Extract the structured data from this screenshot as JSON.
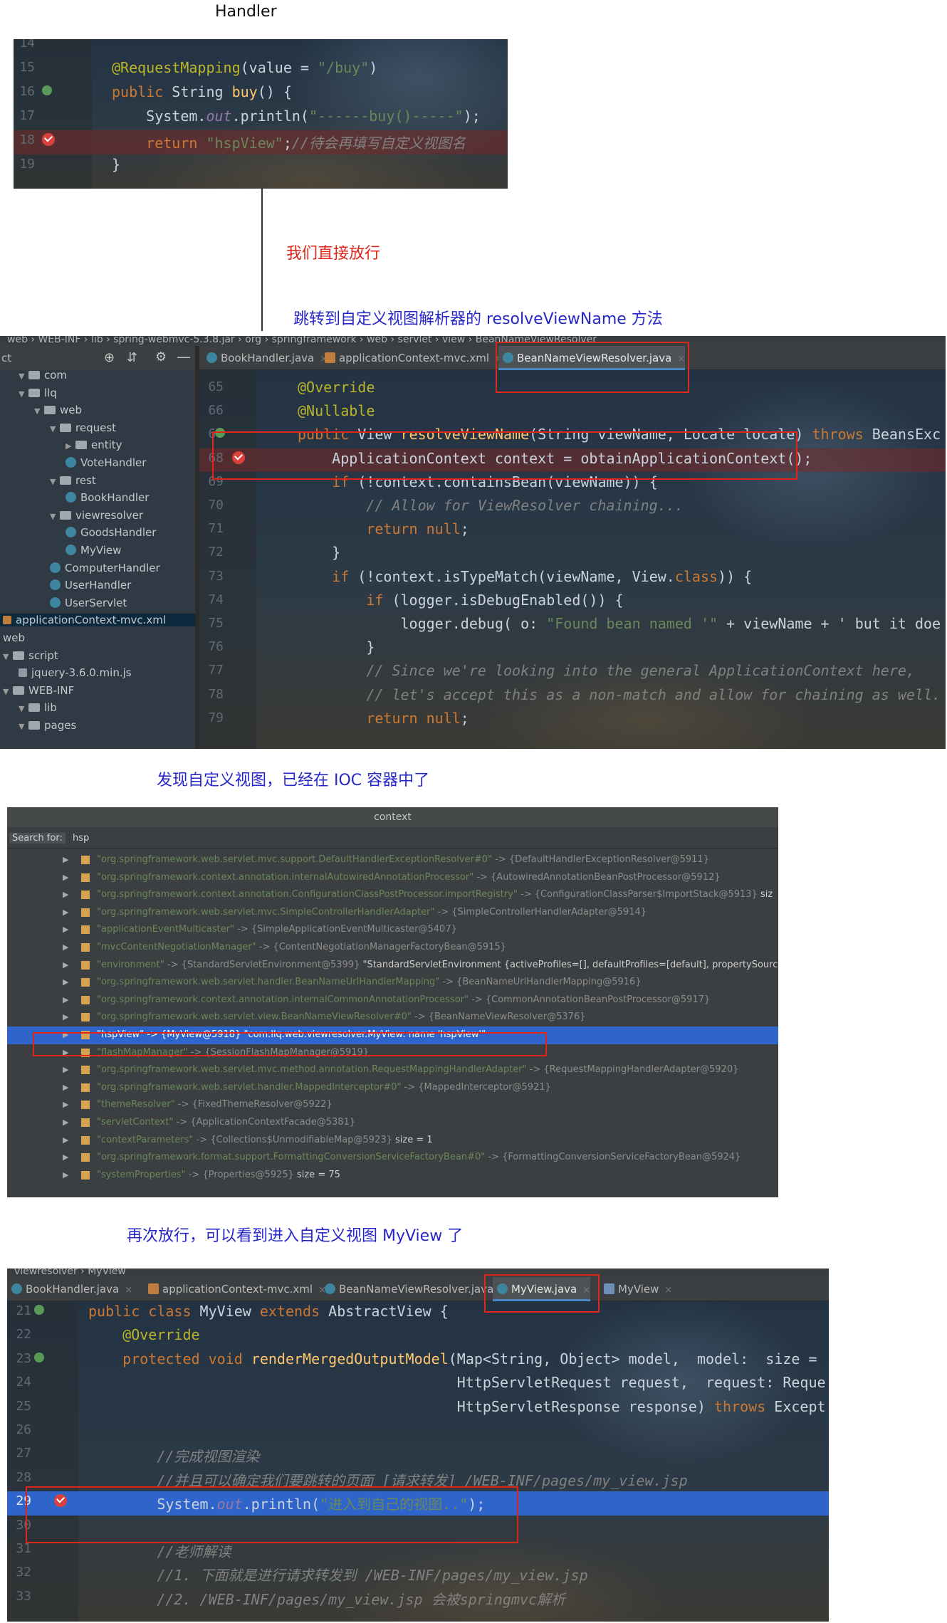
{
  "annotations": {
    "handler_label": "Handler",
    "step1": "我们直接放行",
    "step2": "跳转到自定义视图解析器的 resolveViewName 方法",
    "step3": "发现自定义视图，已经在 IOC 容器中了",
    "step4": "再次放行，可以看到进入自定义视图 MyView 了"
  },
  "colors": {
    "annotation_red": "#e0261b",
    "annotation_blue": "#2727c9",
    "editor_bg": "#27313c",
    "selection_blue": "#2f65ca"
  },
  "panel1": {
    "lines": [
      {
        "num": "14",
        "code": ""
      },
      {
        "num": "15",
        "code": "@RequestMapping(value = \"/buy\")"
      },
      {
        "num": "16",
        "code": "public String buy() {"
      },
      {
        "num": "17",
        "code": "    System.out.println(\"------buy()-----\");"
      },
      {
        "num": "18",
        "code": "    return \"hspView\";//待会再填写自定义视图名"
      },
      {
        "num": "19",
        "code": "}"
      }
    ]
  },
  "panel2": {
    "breadcrumb": [
      "web",
      "WEB-INF",
      "lib",
      "spring-webmvc-5.3.8.jar",
      "org",
      "springframework",
      "web",
      "servlet",
      "view",
      "BeanNameViewResolver"
    ],
    "tabs": [
      {
        "label": "BookHandler.java",
        "icon": "class-icon"
      },
      {
        "label": "applicationContext-mvc.xml",
        "icon": "xml-icon"
      },
      {
        "label": "BeanNameViewResolver.java",
        "icon": "class-icon",
        "active": true
      }
    ],
    "tree": [
      {
        "label": "ct",
        "kind": "text"
      },
      {
        "label": "com",
        "kind": "folder"
      },
      {
        "label": "llq",
        "kind": "folder"
      },
      {
        "label": "web",
        "kind": "folder"
      },
      {
        "label": "request",
        "kind": "folder"
      },
      {
        "label": "entity",
        "kind": "folder"
      },
      {
        "label": "VoteHandler",
        "kind": "class"
      },
      {
        "label": "rest",
        "kind": "folder"
      },
      {
        "label": "BookHandler",
        "kind": "class"
      },
      {
        "label": "viewresolver",
        "kind": "folder"
      },
      {
        "label": "GoodsHandler",
        "kind": "class"
      },
      {
        "label": "MyView",
        "kind": "class"
      },
      {
        "label": "ComputerHandler",
        "kind": "class"
      },
      {
        "label": "UserHandler",
        "kind": "class"
      },
      {
        "label": "UserServlet",
        "kind": "class"
      },
      {
        "label": "applicationContext-mvc.xml",
        "kind": "xml"
      },
      {
        "label": "web",
        "kind": "text"
      },
      {
        "label": "script",
        "kind": "folder"
      },
      {
        "label": "jquery-3.6.0.min.js",
        "kind": "file"
      },
      {
        "label": "WEB-INF",
        "kind": "folder"
      },
      {
        "label": "lib",
        "kind": "folder"
      },
      {
        "label": "pages",
        "kind": "folder"
      }
    ],
    "lines": [
      {
        "num": "65",
        "code": "@Override"
      },
      {
        "num": "66",
        "code": "@Nullable"
      },
      {
        "num": "67",
        "code": "public View resolveViewName(String viewName, Locale locale) throws BeansExc"
      },
      {
        "num": "68",
        "code": "    ApplicationContext context = obtainApplicationContext();"
      },
      {
        "num": "69",
        "code": "    if (!context.containsBean(viewName)) {"
      },
      {
        "num": "70",
        "code": "        // Allow for ViewResolver chaining..."
      },
      {
        "num": "71",
        "code": "        return null;"
      },
      {
        "num": "72",
        "code": "    }"
      },
      {
        "num": "73",
        "code": "    if (!context.isTypeMatch(viewName, View.class)) {"
      },
      {
        "num": "74",
        "code": "        if (logger.isDebugEnabled()) {"
      },
      {
        "num": "75",
        "code": "            logger.debug( o: \"Found bean named '\" + viewName + \"' but it doe"
      },
      {
        "num": "76",
        "code": "        }"
      },
      {
        "num": "77",
        "code": "        // Since we're looking into the general ApplicationContext here,"
      },
      {
        "num": "78",
        "code": "        // let's accept this as a non-match and allow for chaining as well."
      },
      {
        "num": "79",
        "code": "        return null;"
      }
    ]
  },
  "panel3": {
    "title": "context",
    "search_label": "Search for:",
    "search_value": "hsp",
    "rows": [
      {
        "key": "\"org.springframework.web.servlet.mvc.support.DefaultHandlerExceptionResolver#0\"",
        "val": " -> {DefaultHandlerExceptionResolver@5911}",
        "extra": ""
      },
      {
        "key": "\"org.springframework.context.annotation.internalAutowiredAnnotationProcessor\"",
        "val": " -> {AutowiredAnnotationBeanPostProcessor@5912}",
        "extra": ""
      },
      {
        "key": "\"org.springframework.context.annotation.ConfigurationClassPostProcessor.importRegistry\"",
        "val": " -> {ConfigurationClassParser$ImportStack@5913}",
        "extra": "  siz"
      },
      {
        "key": "\"org.springframework.web.servlet.mvc.SimpleControllerHandlerAdapter\"",
        "val": " -> {SimpleControllerHandlerAdapter@5914}",
        "extra": ""
      },
      {
        "key": "\"applicationEventMulticaster\"",
        "val": " -> {SimpleApplicationEventMulticaster@5407}",
        "extra": ""
      },
      {
        "key": "\"mvcContentNegotiationManager\"",
        "val": " -> {ContentNegotiationManagerFactoryBean@5915}",
        "extra": ""
      },
      {
        "key": "\"environment\"",
        "val": " -> {StandardServletEnvironment@5399}",
        "extra": " \"StandardServletEnvironment {activeProfiles=[], defaultProfiles=[default], propertySource"
      },
      {
        "key": "\"org.springframework.web.servlet.handler.BeanNameUrlHandlerMapping\"",
        "val": " -> {BeanNameUrlHandlerMapping@5916}",
        "extra": ""
      },
      {
        "key": "\"org.springframework.context.annotation.internalCommonAnnotationProcessor\"",
        "val": " -> {CommonAnnotationBeanPostProcessor@5917}",
        "extra": ""
      },
      {
        "key": "\"org.springframework.web.servlet.view.BeanNameViewResolver#0\"",
        "val": " -> {BeanNameViewResolver@5376}",
        "extra": ""
      },
      {
        "key": "\"hspView\"",
        "val": " -> {MyView@5918}",
        "extra": " \"com.llq.web.viewresolver.MyView: name 'hspView'\"",
        "selected": true
      },
      {
        "key": "\"flashMapManager\"",
        "val": " -> {SessionFlashMapManager@5919}",
        "extra": ""
      },
      {
        "key": "\"org.springframework.web.servlet.mvc.method.annotation.RequestMappingHandlerAdapter\"",
        "val": " -> {RequestMappingHandlerAdapter@5920}",
        "extra": ""
      },
      {
        "key": "\"org.springframework.web.servlet.handler.MappedInterceptor#0\"",
        "val": " -> {MappedInterceptor@5921}",
        "extra": ""
      },
      {
        "key": "\"themeResolver\"",
        "val": " -> {FixedThemeResolver@5922}",
        "extra": ""
      },
      {
        "key": "\"servletContext\"",
        "val": " -> {ApplicationContextFacade@5381}",
        "extra": ""
      },
      {
        "key": "\"contextParameters\"",
        "val": " -> {Collections$UnmodifiableMap@5923}",
        "extra": "  size = 1"
      },
      {
        "key": "\"org.springframework.format.support.FormattingConversionServiceFactoryBean#0\"",
        "val": " -> {FormattingConversionServiceFactoryBean@5924}",
        "extra": ""
      },
      {
        "key": "\"systemProperties\"",
        "val": " -> {Properties@5925}",
        "extra": "  size = 75"
      }
    ]
  },
  "panel4": {
    "breadcrumb": [
      "viewresolver",
      "MyView"
    ],
    "tabs": [
      {
        "label": "BookHandler.java",
        "icon": "class-icon"
      },
      {
        "label": "applicationContext-mvc.xml",
        "icon": "xml-icon"
      },
      {
        "label": "BeanNameViewResolver.java",
        "icon": "class-icon"
      },
      {
        "label": "MyView.java",
        "icon": "class-icon",
        "active": true
      },
      {
        "label": "MyView",
        "icon": "view-icon"
      }
    ],
    "lines": [
      {
        "num": "21",
        "code": "public class MyView extends AbstractView {"
      },
      {
        "num": "22",
        "code": "    @Override"
      },
      {
        "num": "23",
        "code": "    protected void renderMergedOutputModel(Map<String, Object> model,  model:  size ="
      },
      {
        "num": "24",
        "code": "                                           HttpServletRequest request,  request: Reque"
      },
      {
        "num": "25",
        "code": "                                           HttpServletResponse response) throws Except"
      },
      {
        "num": "26",
        "code": ""
      },
      {
        "num": "27",
        "code": "        //完成视图渲染"
      },
      {
        "num": "28",
        "code": "        //并且可以确定我们要跳转的页面 [请求转发] /WEB-INF/pages/my_view.jsp"
      },
      {
        "num": "29",
        "code": "        System.out.println(\"进入到自己的视图..\");"
      },
      {
        "num": "30",
        "code": ""
      },
      {
        "num": "31",
        "code": "        //老师解读"
      },
      {
        "num": "32",
        "code": "        //1. 下面就是进行请求转发到 /WEB-INF/pages/my_view.jsp"
      },
      {
        "num": "33",
        "code": "        //2. /WEB-INF/pages/my_view.jsp 会被springmvc解析"
      }
    ]
  }
}
